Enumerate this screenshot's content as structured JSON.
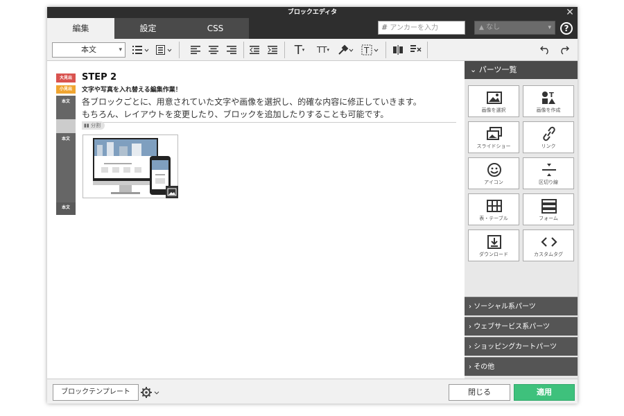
{
  "window": {
    "title": "ブロックエディタ",
    "close": "✕"
  },
  "tabs": [
    {
      "label": "編集"
    },
    {
      "label": "設定"
    },
    {
      "label": "CSS"
    }
  ],
  "anchor": {
    "prefix": "#",
    "placeholder": "アンカーを入力"
  },
  "anchor_select": {
    "value": "なし"
  },
  "help": "?",
  "toolbar": {
    "style_select": "本文",
    "text_icon": "T",
    "text_size_icon": "TT"
  },
  "content": {
    "tags": {
      "heading_large": "大見出",
      "heading_small": "小見出",
      "body": "本文"
    },
    "step_title": "STEP 2",
    "subtitle": "文字や写真を入れ替える編集作業！",
    "paragraph_line1": "各ブロックごとに、用意されていた文字や画像を選択し、的確な内容に修正していきます。",
    "paragraph_line2": "もちろん、レイアウトを変更したり、ブロックを追加したりすることも可能です。",
    "split_label": "分割"
  },
  "sidebar": {
    "header": "パーツ一覧",
    "parts": [
      {
        "label": "画像を選択",
        "icon": "image-icon"
      },
      {
        "label": "画像を作成",
        "icon": "shapes-icon"
      },
      {
        "label": "スライドショー",
        "icon": "slideshow-icon"
      },
      {
        "label": "リンク",
        "icon": "link-icon"
      },
      {
        "label": "アイコン",
        "icon": "smiley-icon"
      },
      {
        "label": "区切り線",
        "icon": "divider-icon"
      },
      {
        "label": "表・テーブル",
        "icon": "table-icon"
      },
      {
        "label": "フォーム",
        "icon": "form-icon"
      },
      {
        "label": "ダウンロード",
        "icon": "download-icon"
      },
      {
        "label": "カスタムタグ",
        "icon": "code-icon"
      }
    ],
    "accordions": [
      {
        "label": "ソーシャル系パーツ"
      },
      {
        "label": "ウェブサービス系パーツ"
      },
      {
        "label": "ショッピングカートパーツ"
      },
      {
        "label": "その他"
      }
    ]
  },
  "footer": {
    "template_button": "ブロックテンプレート",
    "close_button": "閉じる",
    "apply_button": "適用"
  },
  "colors": {
    "title_bar": "#2e2e2e",
    "apply": "#3ec17c",
    "tag_red": "#d9534f",
    "tag_orange": "#f0a531"
  }
}
